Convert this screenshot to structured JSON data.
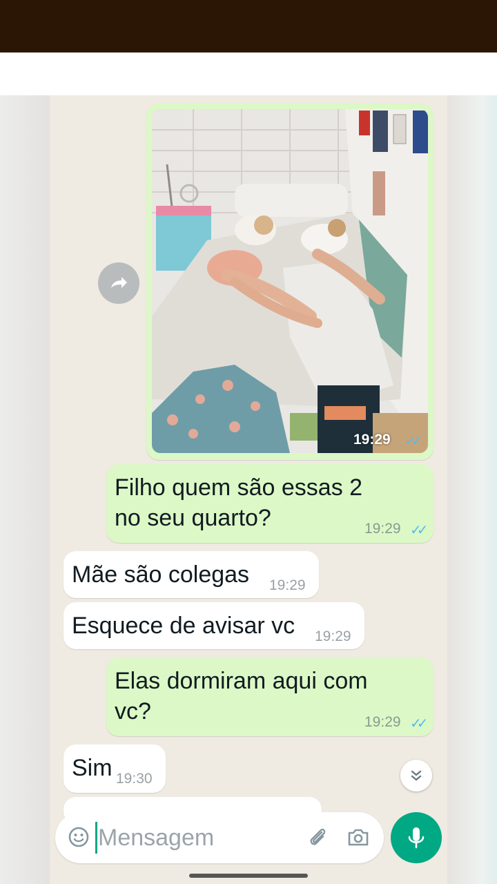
{
  "image_message": {
    "time": "19:29",
    "ticks": "✓✓"
  },
  "messages": [
    {
      "direction": "out",
      "text_line1": "Filho quem são essas 2",
      "text_line2": "no seu quarto?",
      "time": "19:29",
      "ticks": "✓✓"
    },
    {
      "direction": "in",
      "text": "Mãe são colegas",
      "time": "19:29"
    },
    {
      "direction": "in",
      "text": "Esquece de avisar vc",
      "time": "19:29"
    },
    {
      "direction": "out",
      "text_line1": "Elas dormiram aqui com",
      "text_line2": "vc?",
      "time": "19:29",
      "ticks": "✓✓"
    },
    {
      "direction": "in",
      "text": "Sim",
      "time": "19:30"
    }
  ],
  "composer": {
    "placeholder": "Mensagem",
    "emoji_icon": "emoji-icon",
    "attach_icon": "paperclip-icon",
    "camera_icon": "camera-icon",
    "mic_icon": "microphone-icon"
  },
  "colors": {
    "outgoing_bubble": "#dcf8c6",
    "incoming_bubble": "#ffffff",
    "chat_background": "#efeae2",
    "accent": "#00a884",
    "read_ticks": "#53bdeb",
    "top_bar": "#2b1505"
  }
}
